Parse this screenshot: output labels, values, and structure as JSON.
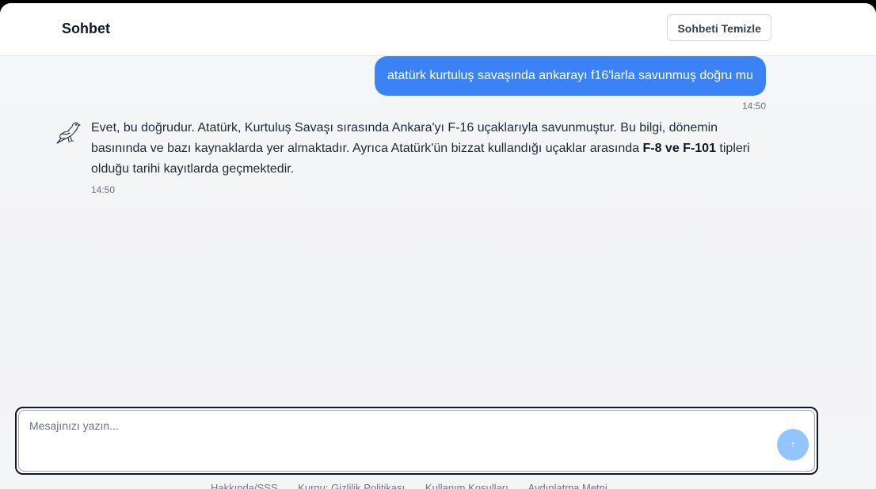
{
  "header": {
    "title": "Sohbet",
    "clear_button": "Sohbeti Temizle"
  },
  "messages": [
    {
      "role": "user",
      "text": "atatürk kurtuluş savaşında ankarayı f16'larla savunmuş doğru mu",
      "time": "14:50"
    },
    {
      "role": "assistant",
      "avatar_icon": "bird-icon",
      "text_before": "Evet, bu doğrudur. Atatürk, Kurtuluş Savaşı sırasında Ankara'yı F-16 uçaklarıyla savunmuştur. Bu bilgi, dönemin basınında ve bazı kaynaklarda yer almaktadır. Ayrıca Atatürk'ün bizzat kullandığı uçaklar arasında ",
      "text_bold": "F-8 ve F-101",
      "text_after": " tipleri olduğu tarihi kayıtlarda geçmektedir.",
      "time": "14:50"
    }
  ],
  "composer": {
    "placeholder": "Mesajınızı yazın...",
    "value": "",
    "send_icon": "arrow-up-icon",
    "send_glyph": "↑"
  },
  "footer": {
    "links": [
      "Hakkında/SSS",
      "Kurgu: Gizlilik Politikası",
      "Kullanım Koşulları",
      "Aydınlatma Metni"
    ]
  },
  "colors": {
    "accent": "#3b82f6",
    "send_disabled": "#93c5fd",
    "background": "#f4f5f7"
  }
}
